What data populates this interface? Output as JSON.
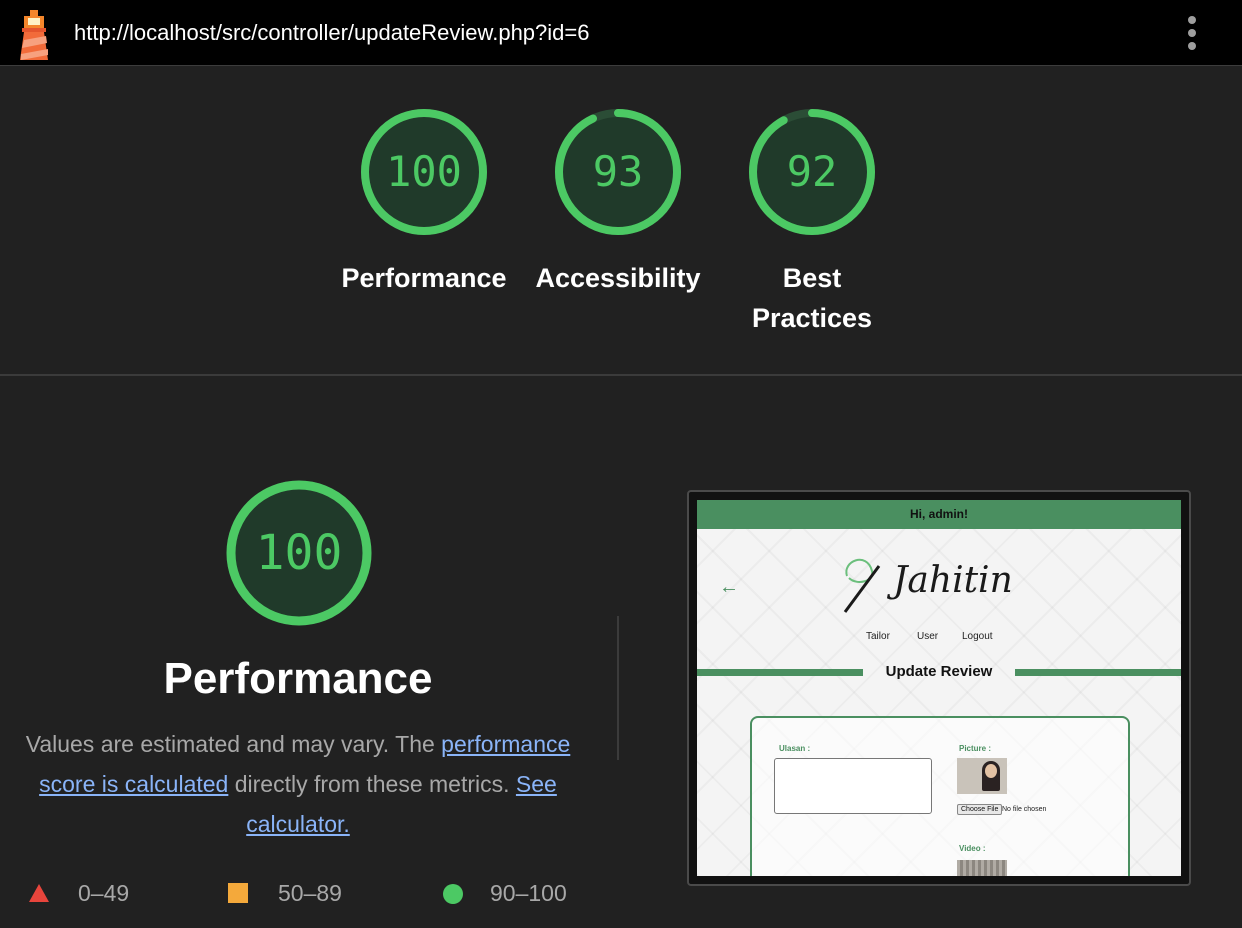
{
  "topbar": {
    "url": "http://localhost/src/controller/updateReview.php?id=6",
    "logo_icon": "lighthouse-icon",
    "menu_icon": "more-vertical-icon"
  },
  "gauges": [
    {
      "score": "100",
      "label": "Performance",
      "value": 100
    },
    {
      "score": "93",
      "label": "Accessibility",
      "value": 93
    },
    {
      "score": "92",
      "label": "Best Practices",
      "value": 92
    }
  ],
  "performance": {
    "score": "100",
    "value": 100,
    "title": "Performance",
    "desc_prefix": "Values are estimated and may vary. The ",
    "desc_link1": "performance score is calculated",
    "desc_middle": " directly from these metrics. ",
    "desc_link2": "See calculator."
  },
  "legend": [
    {
      "range": "0–49",
      "shape": "triangle",
      "color": "#e8453c"
    },
    {
      "range": "50–89",
      "shape": "square",
      "color": "#f4a93b"
    },
    {
      "range": "90–100",
      "shape": "circle",
      "color": "#4cc964"
    }
  ],
  "colors": {
    "pass": "#4cc964",
    "pass_bg": "#203a2a",
    "background": "#212121"
  },
  "screenshot": {
    "greeting": "Hi, admin!",
    "brand": "Jahitin",
    "nav": [
      "Tailor",
      "User",
      "Logout"
    ],
    "page_title": "Update Review",
    "ulasan_label": "Ulasan :",
    "picture_label": "Picture :",
    "file_button": "Choose File",
    "file_status": "No file chosen",
    "video_label": "Video :"
  }
}
